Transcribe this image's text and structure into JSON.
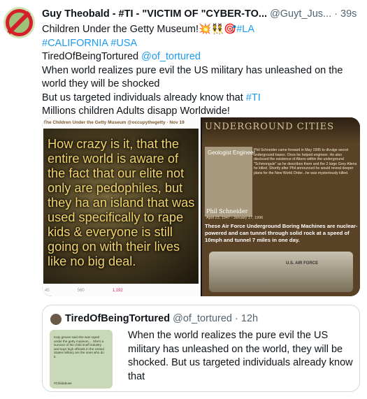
{
  "author": {
    "name": "Guy Theobald - #TI - \"VICTIM OF \"CYBER-TO...",
    "handle": "@Guyt_Jus...",
    "time": "· 39s"
  },
  "tweet": {
    "line1_text": "Children Under the Getty Museum!💥👯🎯",
    "line1_tag": "#LA",
    "tags_line": "#CALIFORNIA #USA",
    "mention_name": "TiredOfBeingTortured",
    "mention_handle": "@of_tortured",
    "line3": "When world realizes pure evil the US military has unleashed on the world they will be shocked",
    "line4_text": "But us targeted individuals already know that",
    "line4_tag": "#TI",
    "line5": "Millions children Adults disapp Worldwide!"
  },
  "media": {
    "left": {
      "header": "The Children Under the Getty Museum @occupythegetty · Nov 19",
      "quote": "How crazy is it, that the entire world is aware of the fact that our elite not only are pedophiles, but they ha an island that was used specifically to rape kids & everyone is still going on with their lives like no big deal.",
      "stat_replies": "45",
      "stat_retweets": "560",
      "stat_likes": "1,192"
    },
    "right": {
      "banner": "UNDERGROUND CITIES",
      "geologist": "Geologist Engineer",
      "paragraph": "Phil Schneider came forward in May 1995 to divulge secret underground bases. Once he helped engineer. He also disclosed the existence of Aliens within the underground \"Schmongule\" as he describes them and the 2 large Grey Aliens he killed. Shortly after Phil announced he would reveal deeper plans for the New World Order...he was mysteriously killed.",
      "person_name": "Phil Schneider",
      "person_dates": "April 23, 1947 - January 17, 1996",
      "caption": "These Air Force Underground Boring Machines are nuclear-powered and can tunnel through solid rock at a speed of 10mph and tunnel 7 miles in one day.",
      "machine_label": "U.S. AIR FORCE"
    }
  },
  "quoted": {
    "name": "TiredOfBeingTortured",
    "handle": "@of_tortured",
    "time": "· 12h",
    "text": "When the world realizes the pure evil the US military has unleashed on the world, they will be shocked. But us targeted individuals already know that",
    "thumb_text": "Katy groves said she was raped under the getty museum.... She's a survivor of the child snuff industry and says high officials in the United States military are the ones who do it.",
    "thumb_tag": "#Childabuse"
  },
  "colors": {
    "link": "#1d9bf0",
    "secondary": "#536471",
    "border": "#cfd9de"
  }
}
